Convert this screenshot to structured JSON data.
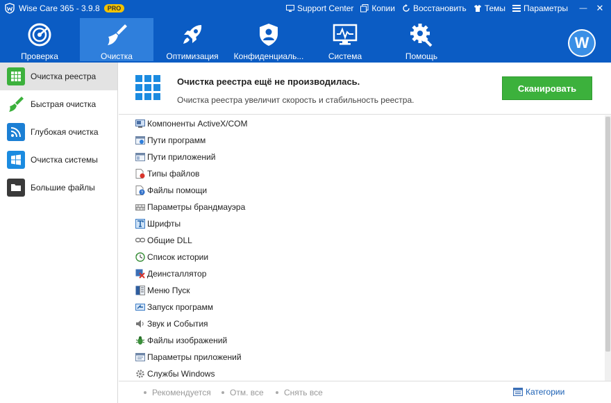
{
  "titlebar": {
    "app_title": "Wise Care 365 - 3.9.8",
    "badge": "PRO",
    "links": [
      {
        "label": "Support Center",
        "icon": "monitor-icon"
      },
      {
        "label": "Копии",
        "icon": "copy-icon"
      },
      {
        "label": "Восстановить",
        "icon": "restore-icon"
      },
      {
        "label": "Темы",
        "icon": "theme-icon"
      },
      {
        "label": "Параметры",
        "icon": "settings-list-icon"
      }
    ],
    "minimize": "—",
    "close": "✕"
  },
  "nav": {
    "tabs": [
      {
        "label": "Проверка",
        "icon": "radar-icon"
      },
      {
        "label": "Очистка",
        "icon": "broom-icon",
        "active": true
      },
      {
        "label": "Оптимизация",
        "icon": "rocket-icon"
      },
      {
        "label": "Конфиденциаль...",
        "icon": "shield-user-icon"
      },
      {
        "label": "Система",
        "icon": "system-monitor-icon"
      },
      {
        "label": "Помощь",
        "icon": "gear-wrench-icon"
      }
    ],
    "avatar_letter": "W"
  },
  "sidebar": {
    "items": [
      {
        "label": "Очистка реестра",
        "icon": "registry-grid-icon",
        "color": "#3cb13c",
        "active": true
      },
      {
        "label": "Быстрая очистка",
        "icon": "broom-icon",
        "color": "#3cb13c"
      },
      {
        "label": "Глубокая очистка",
        "icon": "deep-clean-icon",
        "color": "#1b7fd4"
      },
      {
        "label": "Очистка системы",
        "icon": "windows-icon",
        "color": "#1b8be0"
      },
      {
        "label": "Большие файлы",
        "icon": "folder-icon",
        "color": "#3a3a3a"
      }
    ]
  },
  "header": {
    "title": "Очистка реестра ещё не производилась.",
    "subtitle": "Очистка реестра увеличит скорость и стабильность реестра.",
    "scan_button": "Сканировать"
  },
  "list": {
    "items": [
      {
        "label": "Компоненты ActiveX/COM",
        "icon": "activex-icon"
      },
      {
        "label": "Пути программ",
        "icon": "program-path-icon"
      },
      {
        "label": "Пути приложений",
        "icon": "app-path-icon"
      },
      {
        "label": "Типы файлов",
        "icon": "file-types-icon"
      },
      {
        "label": "Файлы помощи",
        "icon": "help-files-icon"
      },
      {
        "label": "Параметры брандмауэра",
        "icon": "firewall-icon"
      },
      {
        "label": "Шрифты",
        "icon": "font-icon"
      },
      {
        "label": "Общие DLL",
        "icon": "dll-icon"
      },
      {
        "label": "Список истории",
        "icon": "history-icon"
      },
      {
        "label": "Деинсталлятор",
        "icon": "uninstaller-icon"
      },
      {
        "label": "Меню Пуск",
        "icon": "start-menu-icon"
      },
      {
        "label": "Запуск программ",
        "icon": "startup-icon"
      },
      {
        "label": "Звук и События",
        "icon": "sound-icon"
      },
      {
        "label": "Файлы изображений",
        "icon": "bug-icon"
      },
      {
        "label": "Параметры приложений",
        "icon": "app-settings-icon"
      },
      {
        "label": "Службы Windows",
        "icon": "services-gear-icon"
      }
    ]
  },
  "footer": {
    "recommended": "Рекомендуется",
    "select_all": "Отм. все",
    "deselect_all": "Снять все",
    "categories": "Категории"
  }
}
